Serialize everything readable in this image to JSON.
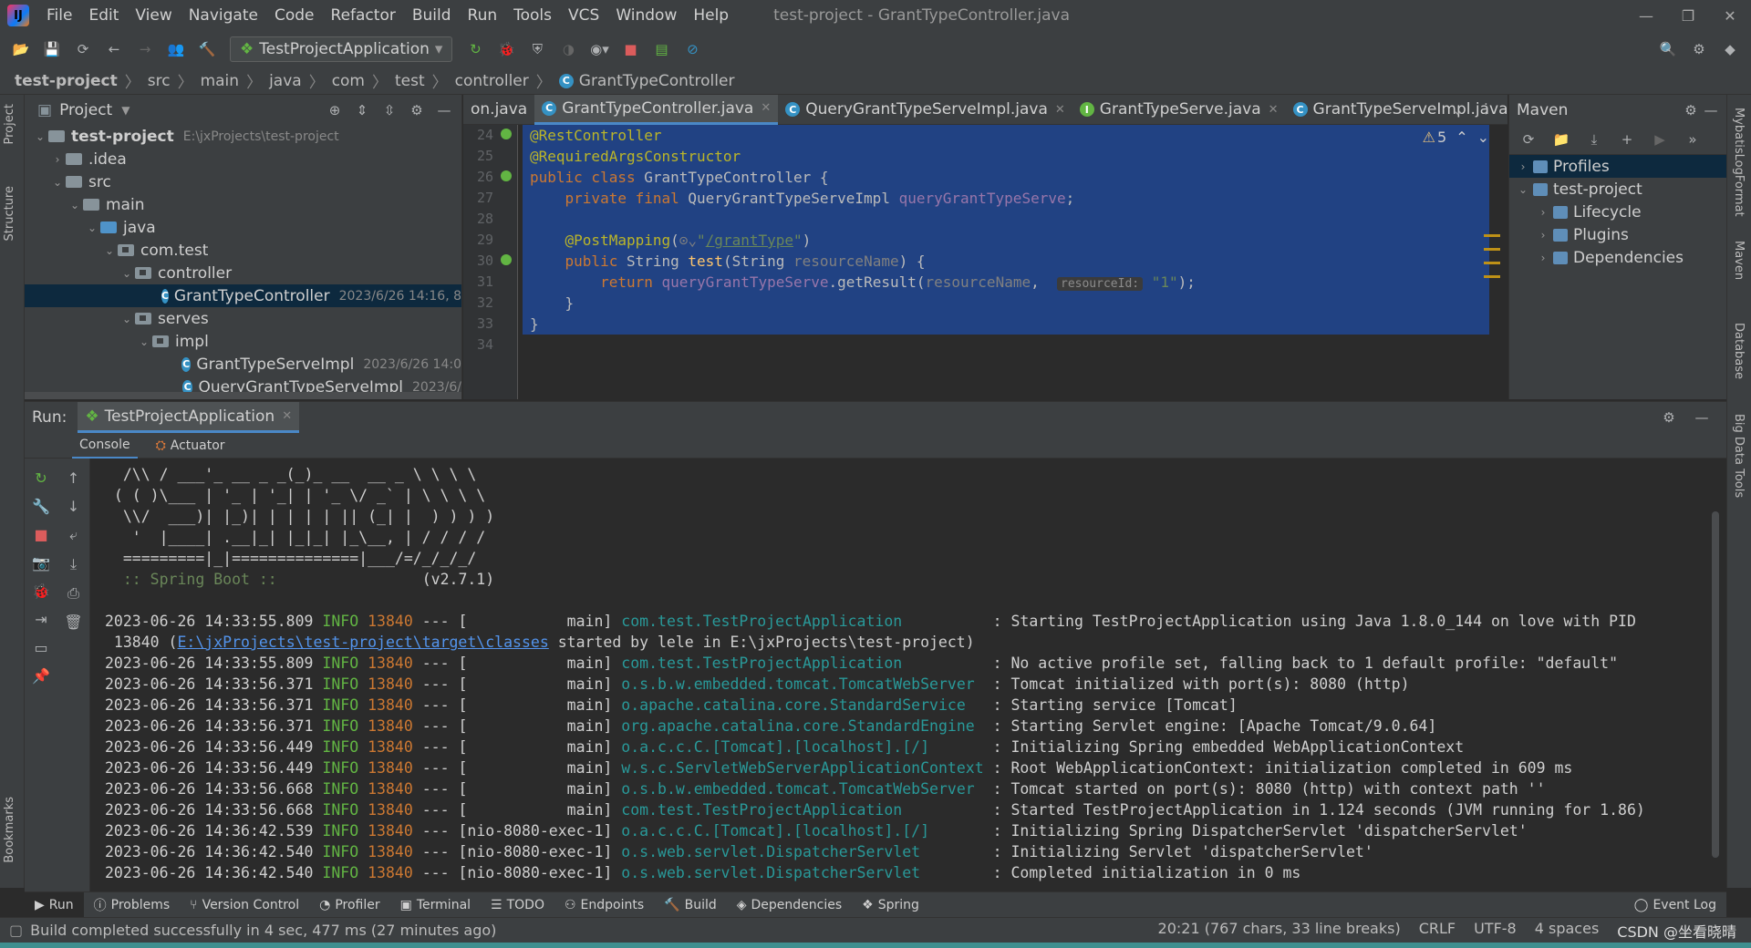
{
  "menubar": {
    "items": [
      "File",
      "Edit",
      "View",
      "Navigate",
      "Code",
      "Refactor",
      "Build",
      "Run",
      "Tools",
      "VCS",
      "Window",
      "Help"
    ],
    "title": "test-project - GrantTypeController.java"
  },
  "toolbar": {
    "run_config": "TestProjectApplication"
  },
  "breadcrumb": [
    "test-project",
    "src",
    "main",
    "java",
    "com",
    "test",
    "controller",
    "GrantTypeController"
  ],
  "left_stripe": [
    "Project",
    "Structure",
    "Bookmarks"
  ],
  "right_stripe": [
    "MybatisLogFormat",
    "Maven",
    "Database",
    "Big Data Tools"
  ],
  "project": {
    "title": "Project",
    "tree": [
      {
        "label": "test-project",
        "meta": "E:\\jxProjects\\test-project",
        "indent": 0,
        "arrow": "v",
        "type": "folder",
        "bold": true
      },
      {
        "label": ".idea",
        "meta": "",
        "indent": 1,
        "arrow": ">",
        "type": "folder"
      },
      {
        "label": "src",
        "meta": "",
        "indent": 1,
        "arrow": "v",
        "type": "folder"
      },
      {
        "label": "main",
        "meta": "",
        "indent": 2,
        "arrow": "v",
        "type": "folder"
      },
      {
        "label": "java",
        "meta": "",
        "indent": 3,
        "arrow": "v",
        "type": "folder-blue"
      },
      {
        "label": "com.test",
        "meta": "",
        "indent": 4,
        "arrow": "v",
        "type": "pkg"
      },
      {
        "label": "controller",
        "meta": "",
        "indent": 5,
        "arrow": "v",
        "type": "pkg"
      },
      {
        "label": "GrantTypeController",
        "meta": "2023/6/26 14:16, 8",
        "indent": 7,
        "arrow": "",
        "type": "class",
        "selected": true
      },
      {
        "label": "serves",
        "meta": "",
        "indent": 5,
        "arrow": "v",
        "type": "pkg"
      },
      {
        "label": "impl",
        "meta": "",
        "indent": 6,
        "arrow": "v",
        "type": "pkg"
      },
      {
        "label": "GrantTypeServeImpl",
        "meta": "2023/6/26 14:0",
        "indent": 8,
        "arrow": "",
        "type": "class"
      },
      {
        "label": "QueryGrantTypeServeImpl",
        "meta": "2023/6/",
        "indent": 8,
        "arrow": "",
        "type": "class"
      }
    ]
  },
  "editor": {
    "tabs": [
      {
        "label": "on.java",
        "icon": "",
        "active": false
      },
      {
        "label": "GrantTypeController.java",
        "icon": "C",
        "active": true
      },
      {
        "label": "QueryGrantTypeServeImpl.java",
        "icon": "C",
        "active": false
      },
      {
        "label": "GrantTypeServe.java",
        "icon": "I",
        "active": false
      },
      {
        "label": "GrantTypeServeImpl.java",
        "icon": "C",
        "active": false
      }
    ],
    "warnings": "5",
    "line_numbers": [
      "24",
      "25",
      "26",
      "27",
      "28",
      "29",
      "30",
      "31",
      "32",
      "33",
      "34"
    ]
  },
  "maven": {
    "title": "Maven",
    "tree": [
      {
        "label": "Profiles",
        "indent": 0,
        "arrow": ">",
        "selected": true
      },
      {
        "label": "test-project",
        "indent": 0,
        "arrow": "v"
      },
      {
        "label": "Lifecycle",
        "indent": 1,
        "arrow": ">"
      },
      {
        "label": "Plugins",
        "indent": 1,
        "arrow": ">"
      },
      {
        "label": "Dependencies",
        "indent": 1,
        "arrow": ">"
      }
    ]
  },
  "run": {
    "label": "Run:",
    "tab": "TestProjectApplication",
    "subtabs": [
      "Console",
      "Actuator"
    ],
    "banner": [
      "  /\\\\ / ___'_ __ _ _(_)_ __  __ _ \\ \\ \\ \\",
      " ( ( )\\___ | '_ | '_| | '_ \\/ _` | \\ \\ \\ \\",
      "  \\\\/  ___)| |_)| | | | | || (_| |  ) ) ) )",
      "   '  |____| .__|_| |_|_| |_\\__, | / / / /",
      "  =========|_|==============|___/=/_/_/_/"
    ],
    "spring_line": "  :: Spring Boot ::",
    "spring_version": "(v2.7.1)",
    "logs": [
      {
        "ts": "2023-06-26 14:33:55.809",
        "level": "INFO",
        "pid": "13840",
        "thread": "[           main]",
        "logger": "com.test.TestProjectApplication         ",
        "msg": ": Starting TestProjectApplication using Java 1.8.0_144 on love with PID"
      },
      {
        "cont_pre": " 13840 (",
        "link": "E:\\jxProjects\\test-project\\target\\classes",
        "cont_post": " started by lele in E:\\jxProjects\\test-project)"
      },
      {
        "ts": "2023-06-26 14:33:55.809",
        "level": "INFO",
        "pid": "13840",
        "thread": "[           main]",
        "logger": "com.test.TestProjectApplication         ",
        "msg": ": No active profile set, falling back to 1 default profile: \"default\""
      },
      {
        "ts": "2023-06-26 14:33:56.371",
        "level": "INFO",
        "pid": "13840",
        "thread": "[           main]",
        "logger": "o.s.b.w.embedded.tomcat.TomcatWebServer ",
        "msg": ": Tomcat initialized with port(s): 8080 (http)"
      },
      {
        "ts": "2023-06-26 14:33:56.371",
        "level": "INFO",
        "pid": "13840",
        "thread": "[           main]",
        "logger": "o.apache.catalina.core.StandardService  ",
        "msg": ": Starting service [Tomcat]"
      },
      {
        "ts": "2023-06-26 14:33:56.371",
        "level": "INFO",
        "pid": "13840",
        "thread": "[           main]",
        "logger": "org.apache.catalina.core.StandardEngine ",
        "msg": ": Starting Servlet engine: [Apache Tomcat/9.0.64]"
      },
      {
        "ts": "2023-06-26 14:33:56.449",
        "level": "INFO",
        "pid": "13840",
        "thread": "[           main]",
        "logger": "o.a.c.c.C.[Tomcat].[localhost].[/]      ",
        "msg": ": Initializing Spring embedded WebApplicationContext"
      },
      {
        "ts": "2023-06-26 14:33:56.449",
        "level": "INFO",
        "pid": "13840",
        "thread": "[           main]",
        "logger": "w.s.c.ServletWebServerApplicationContext",
        "msg": ": Root WebApplicationContext: initialization completed in 609 ms"
      },
      {
        "ts": "2023-06-26 14:33:56.668",
        "level": "INFO",
        "pid": "13840",
        "thread": "[           main]",
        "logger": "o.s.b.w.embedded.tomcat.TomcatWebServer ",
        "msg": ": Tomcat started on port(s): 8080 (http) with context path ''"
      },
      {
        "ts": "2023-06-26 14:33:56.668",
        "level": "INFO",
        "pid": "13840",
        "thread": "[           main]",
        "logger": "com.test.TestProjectApplication         ",
        "msg": ": Started TestProjectApplication in 1.124 seconds (JVM running for 1.86)"
      },
      {
        "ts": "2023-06-26 14:36:42.539",
        "level": "INFO",
        "pid": "13840",
        "thread": "[nio-8080-exec-1]",
        "logger": "o.a.c.c.C.[Tomcat].[localhost].[/]      ",
        "msg": ": Initializing Spring DispatcherServlet 'dispatcherServlet'"
      },
      {
        "ts": "2023-06-26 14:36:42.540",
        "level": "INFO",
        "pid": "13840",
        "thread": "[nio-8080-exec-1]",
        "logger": "o.s.web.servlet.DispatcherServlet       ",
        "msg": ": Initializing Servlet 'dispatcherServlet'"
      },
      {
        "ts": "2023-06-26 14:36:42.540",
        "level": "INFO",
        "pid": "13840",
        "thread": "[nio-8080-exec-1]",
        "logger": "o.s.web.servlet.DispatcherServlet       ",
        "msg": ": Completed initialization in 0 ms"
      }
    ]
  },
  "tool_windows": [
    "Run",
    "Problems",
    "Version Control",
    "Profiler",
    "Terminal",
    "TODO",
    "Endpoints",
    "Build",
    "Dependencies",
    "Spring"
  ],
  "event_log": "Event Log",
  "status": {
    "message": "Build completed successfully in 4 sec, 477 ms (27 minutes ago)",
    "position": "20:21 (767 chars, 33 line breaks)",
    "line_sep": "CRLF",
    "encoding": "UTF-8",
    "indent": "4 spaces",
    "watermark": "CSDN @坐看晓晴"
  }
}
